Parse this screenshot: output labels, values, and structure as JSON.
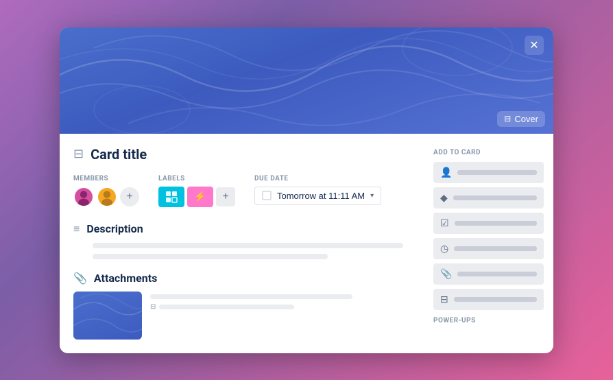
{
  "modal": {
    "close_label": "✕",
    "cover_label": "Cover",
    "card_title": "Card title",
    "sections": {
      "members_label": "MEMBERS",
      "labels_label": "LABELS",
      "due_date_label": "DUE DATE",
      "due_date_value": "Tomorrow at 11:11 AM",
      "add_to_card_label": "ADD TO CARD",
      "description_label": "Description",
      "attachments_label": "Attachments",
      "power_ups_label": "POWER-UPS"
    },
    "sidebar_buttons": [
      {
        "icon": "👤",
        "label": ""
      },
      {
        "icon": "◆",
        "label": ""
      },
      {
        "icon": "☑",
        "label": ""
      },
      {
        "icon": "🕐",
        "label": ""
      },
      {
        "icon": "📎",
        "label": ""
      },
      {
        "icon": "🖥",
        "label": ""
      }
    ]
  }
}
